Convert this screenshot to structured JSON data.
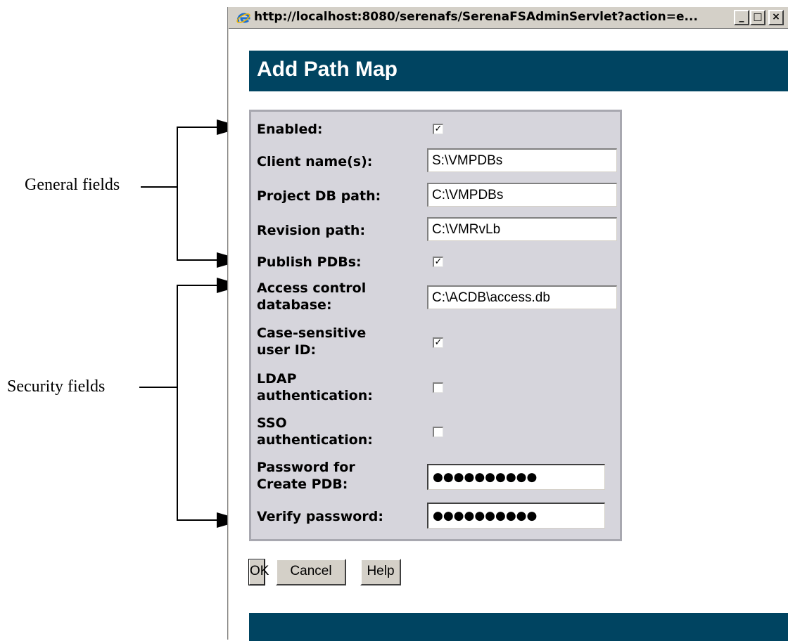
{
  "annotations": {
    "general": "General fields",
    "security": "Security fields"
  },
  "window": {
    "title": "http://localhost:8080/serenafs/SerenaFSAdminServlet?action=e...",
    "minimize": "_",
    "maximize": "□",
    "close": "×"
  },
  "page": {
    "title": "Add Path Map"
  },
  "form": {
    "enabled": {
      "label": "Enabled:",
      "checked": true
    },
    "client_names": {
      "label": "Client name(s):",
      "value": "S:\\VMPDBs"
    },
    "project_db_path": {
      "label": "Project DB path:",
      "value": "C:\\VMPDBs"
    },
    "revision_path": {
      "label": "Revision path:",
      "value": "C:\\VMRvLb"
    },
    "publish_pdbs": {
      "label": "Publish PDBs:",
      "checked": true
    },
    "access_control_db": {
      "label_line1": "Access control",
      "label_line2": "database:",
      "value": "C:\\ACDB\\access.db"
    },
    "case_sensitive": {
      "label_line1": "Case-sensitive",
      "label_line2": "user ID:",
      "checked": true
    },
    "ldap_auth": {
      "label_line1": "LDAP",
      "label_line2": "authentication:",
      "checked": false
    },
    "sso_auth": {
      "label_line1": "SSO",
      "label_line2": "authentication:",
      "checked": false
    },
    "password_create_pdb": {
      "label_line1": "Password for",
      "label_line2": "Create PDB:",
      "value": "●●●●●●●●●●"
    },
    "verify_password": {
      "label": "Verify password:",
      "value": "●●●●●●●●●●"
    }
  },
  "buttons": {
    "ok": "OK",
    "cancel": "Cancel",
    "help": "Help"
  },
  "colors": {
    "header": "#004461",
    "panel": "#d6d5dc"
  }
}
